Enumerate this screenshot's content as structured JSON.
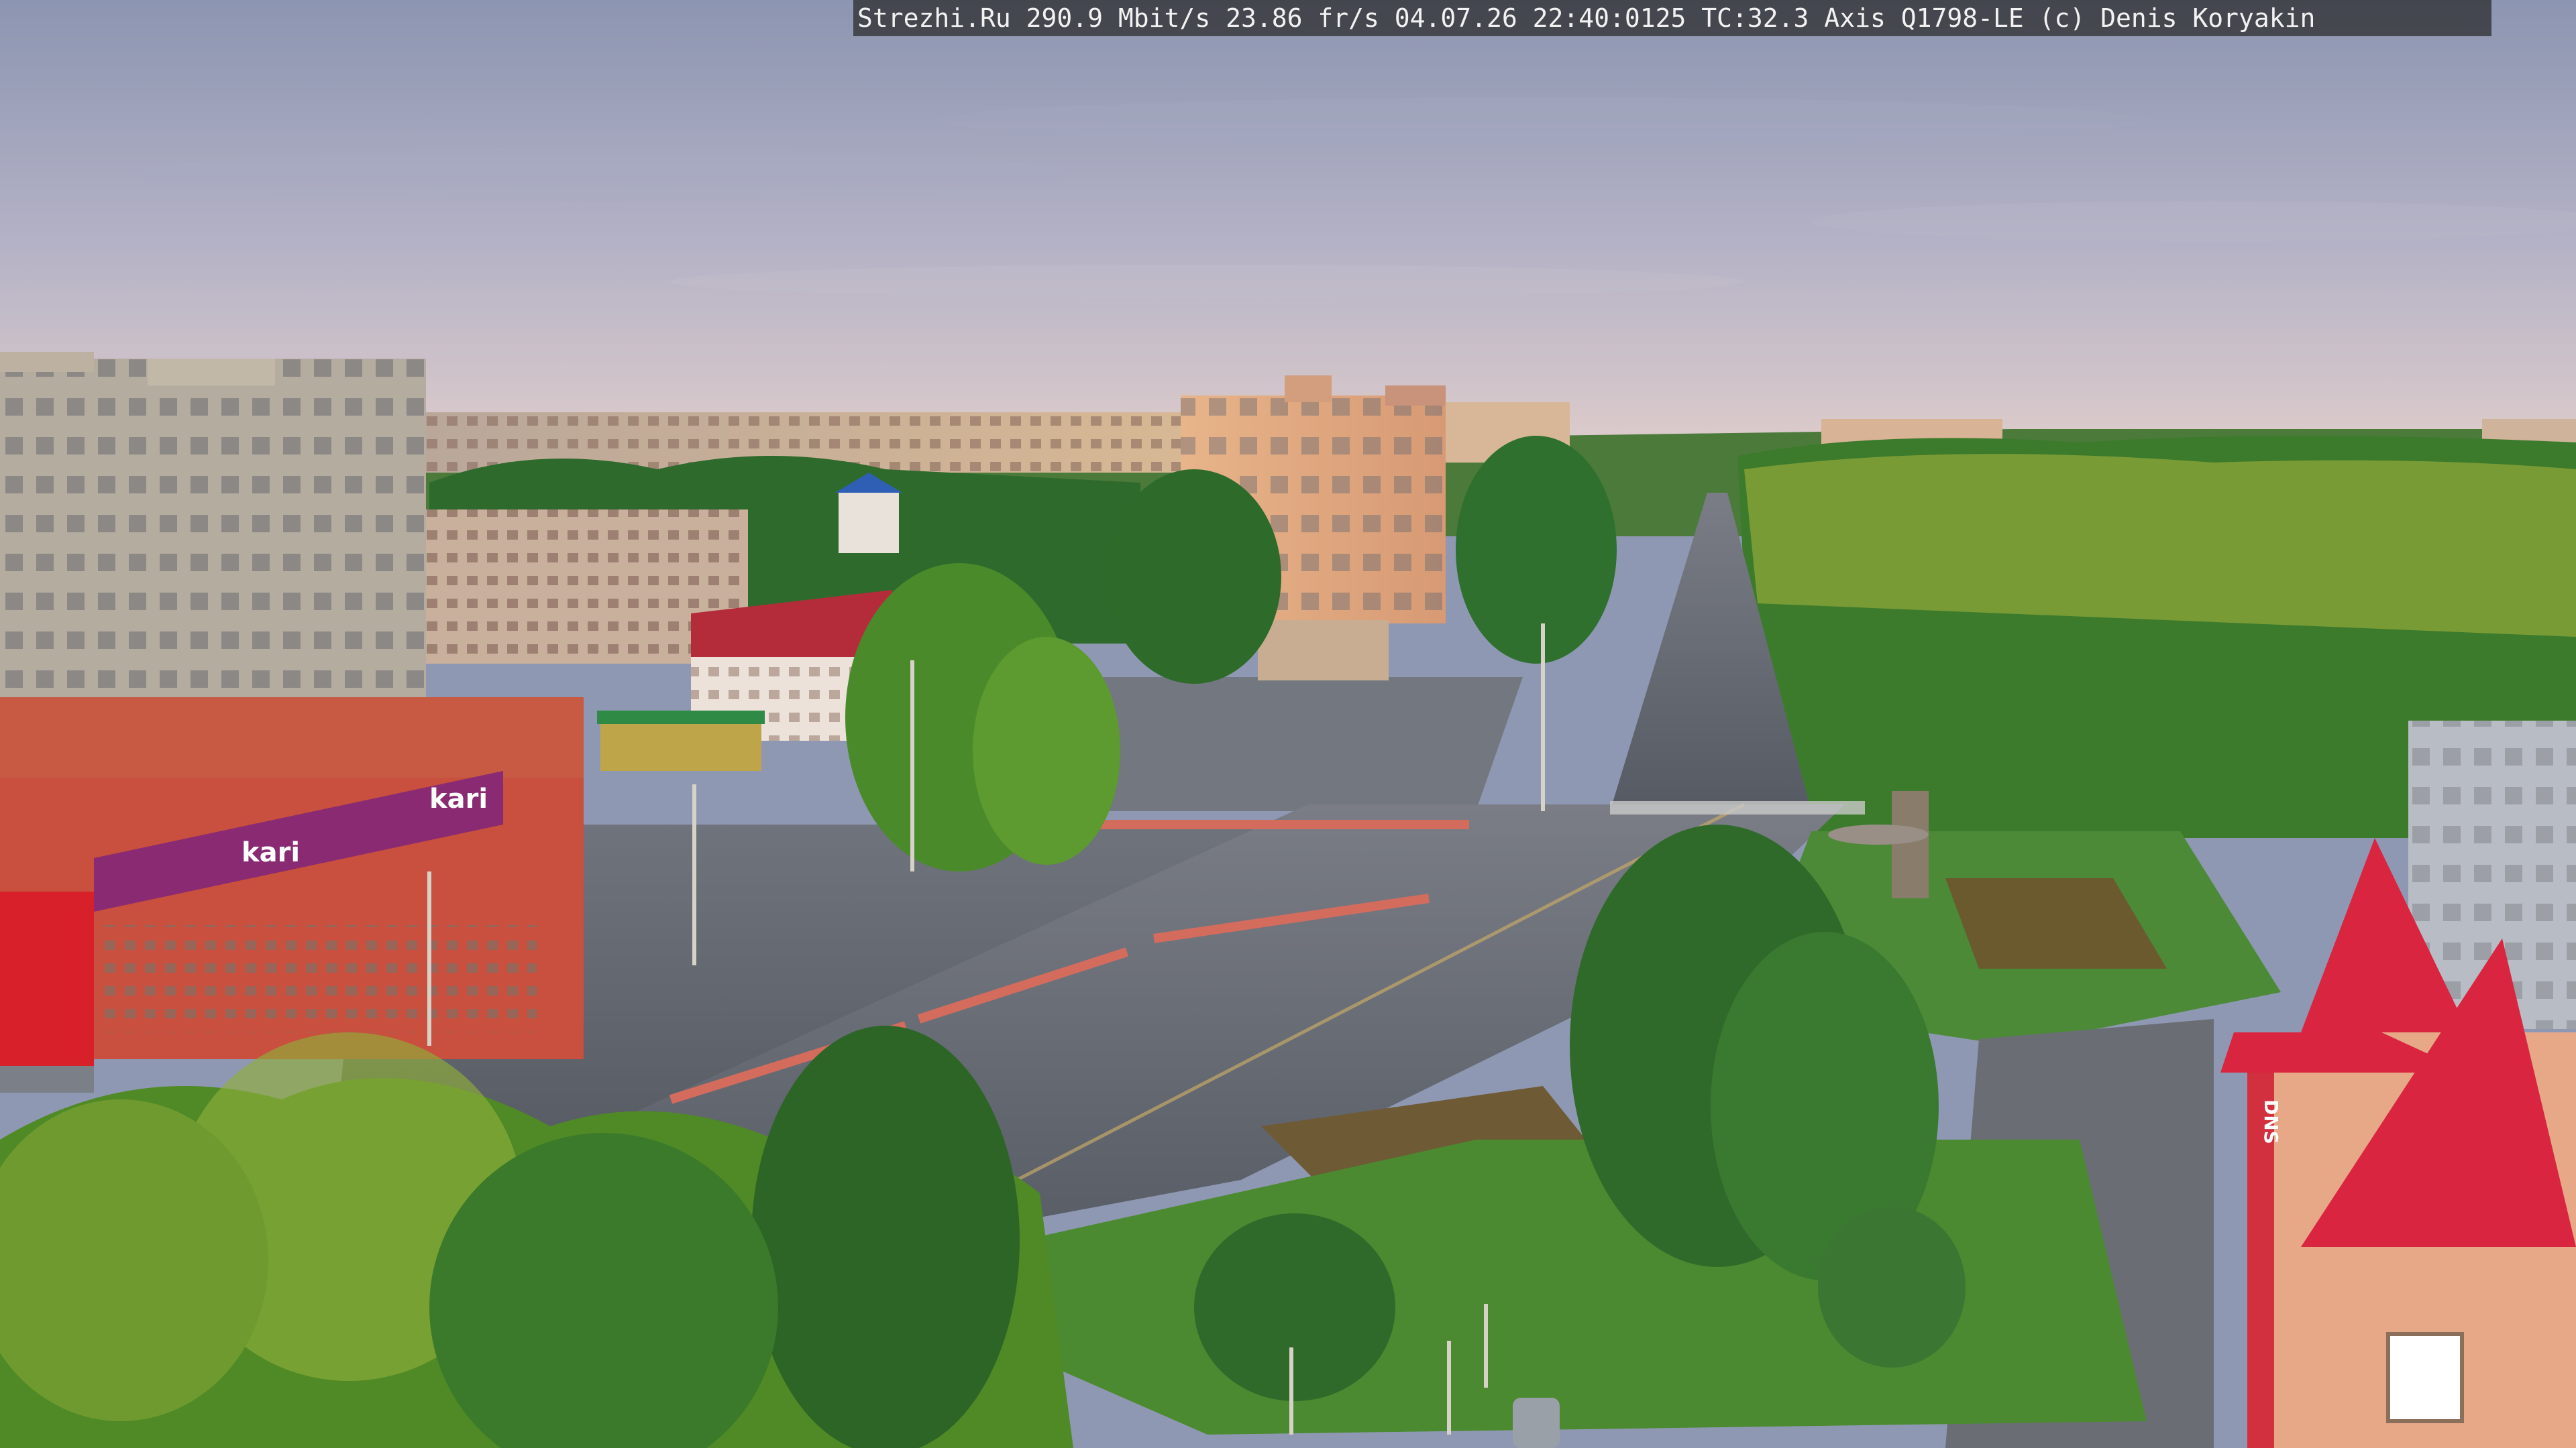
{
  "camera": {
    "overlay_text": "Strezhi.Ru 290.9 Mbit/s 23.86 fr/s 04.07.26 22:40:0125 TC:32.3  Axis Q1798-LE  (c) Denis Koryakin"
  },
  "signs": {
    "store_left": "kari",
    "store_small": "kari",
    "store_right": "DNS"
  },
  "colors": {
    "sky_top": "#8e97b2",
    "sky_bottom": "#d6c8cc",
    "trees": "#3f7a2c",
    "road": "#5d626b",
    "store_facade": "#c9503e",
    "store_banner": "#8a2a72",
    "roof_red": "#d9253f"
  }
}
